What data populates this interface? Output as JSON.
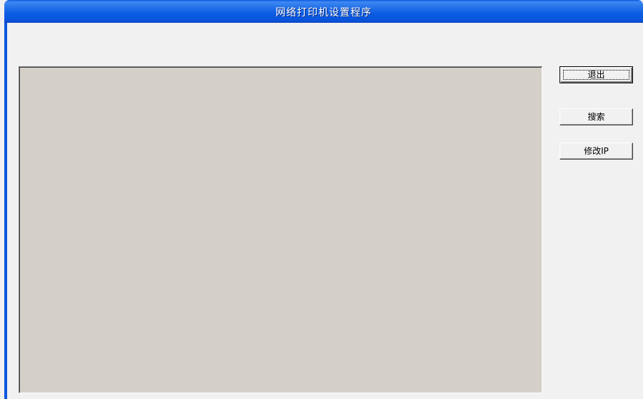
{
  "window": {
    "title": "网络打印机设置程序"
  },
  "buttons": {
    "exit_label": "退出",
    "search_label": "搜索",
    "modify_ip_label": "修改IP"
  },
  "device_list": {
    "items": []
  }
}
